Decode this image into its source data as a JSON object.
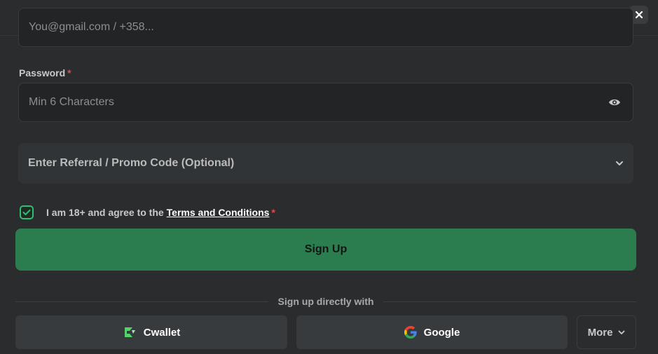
{
  "form": {
    "email": {
      "placeholder": "You@gmail.com / +358...",
      "value": ""
    },
    "password": {
      "label": "Password",
      "required_mark": "*",
      "placeholder": "Min 6 Characters",
      "value": "",
      "toggle_icon": "eye-icon"
    },
    "promo": {
      "label": "Enter Referral / Promo Code (Optional)",
      "icon": "chevron-down-icon"
    },
    "terms": {
      "checked": true,
      "text": "I am 18+ and agree to the",
      "link": "Terms and Conditions",
      "required_mark": "*"
    },
    "submit_label": "Sign Up"
  },
  "social": {
    "divider_text": "Sign up directly with",
    "buttons": [
      {
        "label": "Cwallet",
        "icon": "cwallet-logo-icon"
      },
      {
        "label": "Google",
        "icon": "google-logo-icon"
      }
    ],
    "more_label": "More"
  },
  "colors": {
    "background": "#2a2c2d",
    "accent": "#2b7d4f",
    "checkbox": "#2fbf71",
    "required": "#e5484d"
  }
}
